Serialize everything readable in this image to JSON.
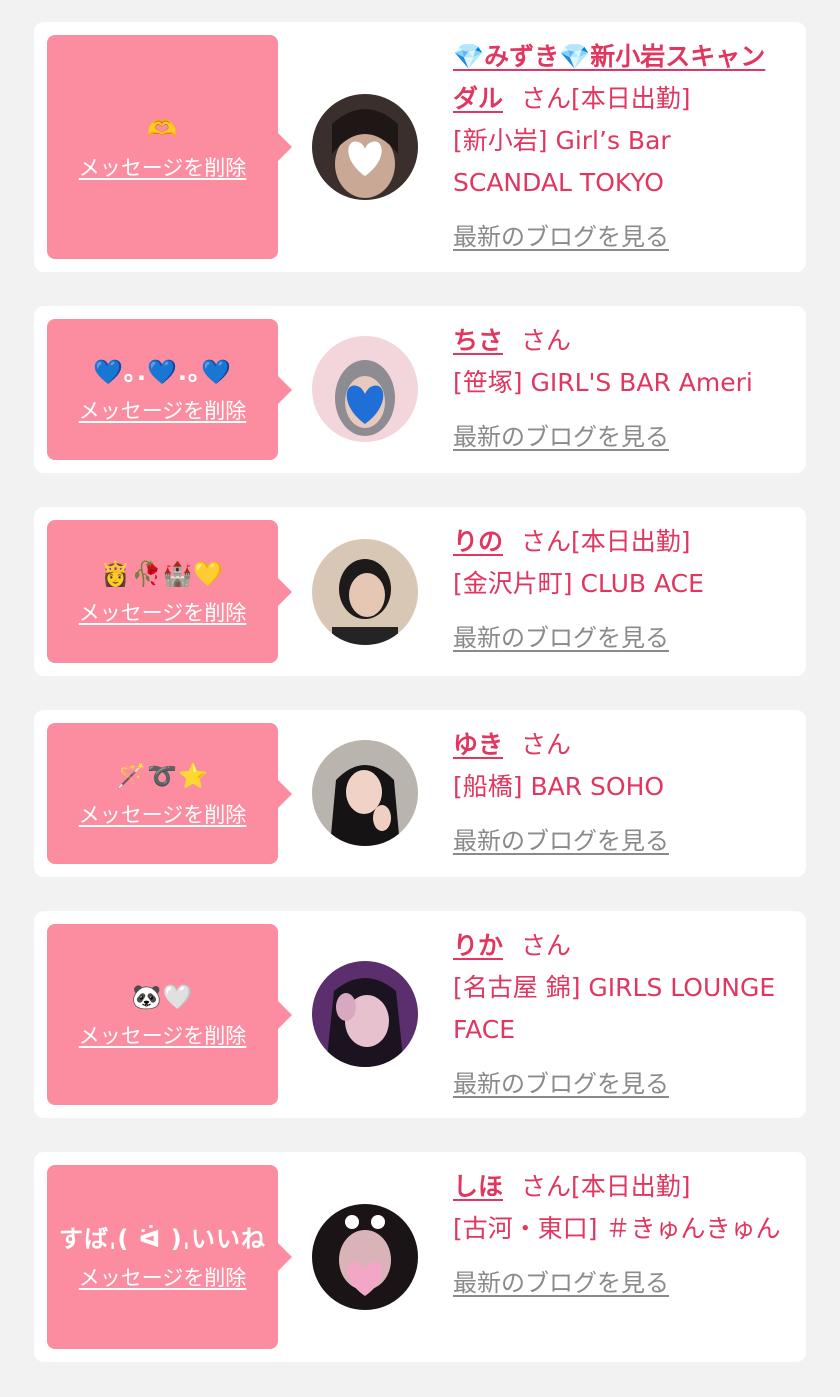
{
  "delete_label": "メッセージを削除",
  "blog_label": "最新のブログを見る",
  "san_label": "さん",
  "colors": {
    "accent": "#e0365f",
    "message_bg": "#fc8da0",
    "link_gray": "#8a8a8a",
    "page_bg": "#f2f2f2"
  },
  "cards": [
    {
      "message": "🫶",
      "name": "💎みずき💎新小岩スキャンダル",
      "status": "[本日出勤]",
      "shop": "[新小岩] Girl’s Bar SCANDAL TOKYO",
      "avatar_icon": "photo-dark-hair-with-heart-sticker"
    },
    {
      "message": "💙｡.💙.｡💙",
      "name": "ちさ",
      "status": "",
      "shop": "[笹塚] GIRL'S BAR Ameri",
      "avatar_icon": "photo-pink-bg-with-blue-heart"
    },
    {
      "message": "👸🥀🏰💛",
      "name": "りの",
      "status": "[本日出勤]",
      "shop": "[金沢片町] CLUB ACE",
      "avatar_icon": "photo-portrait-black-hair"
    },
    {
      "message": "🪄➰⭐️",
      "name": "ゆき",
      "status": "",
      "shop": "[船橋] BAR SOHO",
      "avatar_icon": "photo-peace-sign"
    },
    {
      "message": "🐼🤍",
      "name": "りか",
      "status": "",
      "shop": "[名古屋 錦] GIRLS LOUNGE FACE",
      "avatar_icon": "photo-purple-lighting"
    },
    {
      "message": "すばˌ( ᐛ )ˌいいね",
      "name": "しほ",
      "status": "[本日出勤]",
      "shop": "[古河・東口] ＃きゅんきゅん",
      "avatar_icon": "photo-pink-heart-mask"
    }
  ]
}
